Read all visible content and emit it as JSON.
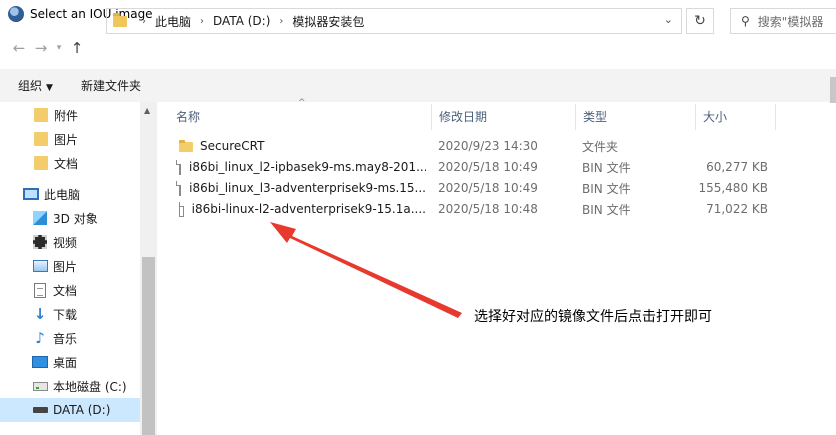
{
  "window": {
    "title": "Select an IOU image"
  },
  "nav": {
    "back_icon": "arrow-left-icon",
    "forward_icon": "arrow-right-icon",
    "recent_icon": "chevron-down-icon",
    "up_icon": "arrow-up-icon"
  },
  "address": {
    "crumbs": [
      "此电脑",
      "DATA (D:)",
      "模拟器安装包"
    ]
  },
  "search": {
    "placeholder": "搜索\"模拟器"
  },
  "commands": {
    "organize": "组织",
    "new_folder": "新建文件夹"
  },
  "sidebar": {
    "items": [
      {
        "label": "附件",
        "icon": "folder-icon"
      },
      {
        "label": "图片",
        "icon": "folder-icon"
      },
      {
        "label": "文档",
        "icon": "folder-icon"
      },
      {
        "label": "此电脑",
        "icon": "computer-icon"
      },
      {
        "label": "3D 对象",
        "icon": "cube-icon"
      },
      {
        "label": "视频",
        "icon": "video-icon"
      },
      {
        "label": "图片",
        "icon": "picture-icon"
      },
      {
        "label": "文档",
        "icon": "document-icon"
      },
      {
        "label": "下载",
        "icon": "download-icon"
      },
      {
        "label": "音乐",
        "icon": "music-icon"
      },
      {
        "label": "桌面",
        "icon": "desktop-icon"
      },
      {
        "label": "本地磁盘 (C:)",
        "icon": "drive-icon"
      },
      {
        "label": "DATA (D:)",
        "icon": "drive-icon"
      }
    ],
    "selected_index": 12
  },
  "columns": {
    "name": "名称",
    "date": "修改日期",
    "type": "类型",
    "size": "大小"
  },
  "files": [
    {
      "name": "SecureCRT",
      "date": "2020/9/23 14:30",
      "type": "文件夹",
      "size": "",
      "kind": "folder"
    },
    {
      "name": "i86bi_linux_l2-ipbasek9-ms.may8-201...",
      "date": "2020/5/18 10:49",
      "type": "BIN 文件",
      "size": "60,277 KB",
      "kind": "file"
    },
    {
      "name": "i86bi_linux_l3-adventerprisek9-ms.15...",
      "date": "2020/5/18 10:49",
      "type": "BIN 文件",
      "size": "155,480 KB",
      "kind": "file"
    },
    {
      "name": "i86bi-linux-l2-adventerprisek9-15.1a....",
      "date": "2020/5/18 10:48",
      "type": "BIN 文件",
      "size": "71,022 KB",
      "kind": "file"
    }
  ],
  "annotation": {
    "text": "选择好对应的镜像文件后点击打开即可",
    "color": "#e8392f"
  }
}
